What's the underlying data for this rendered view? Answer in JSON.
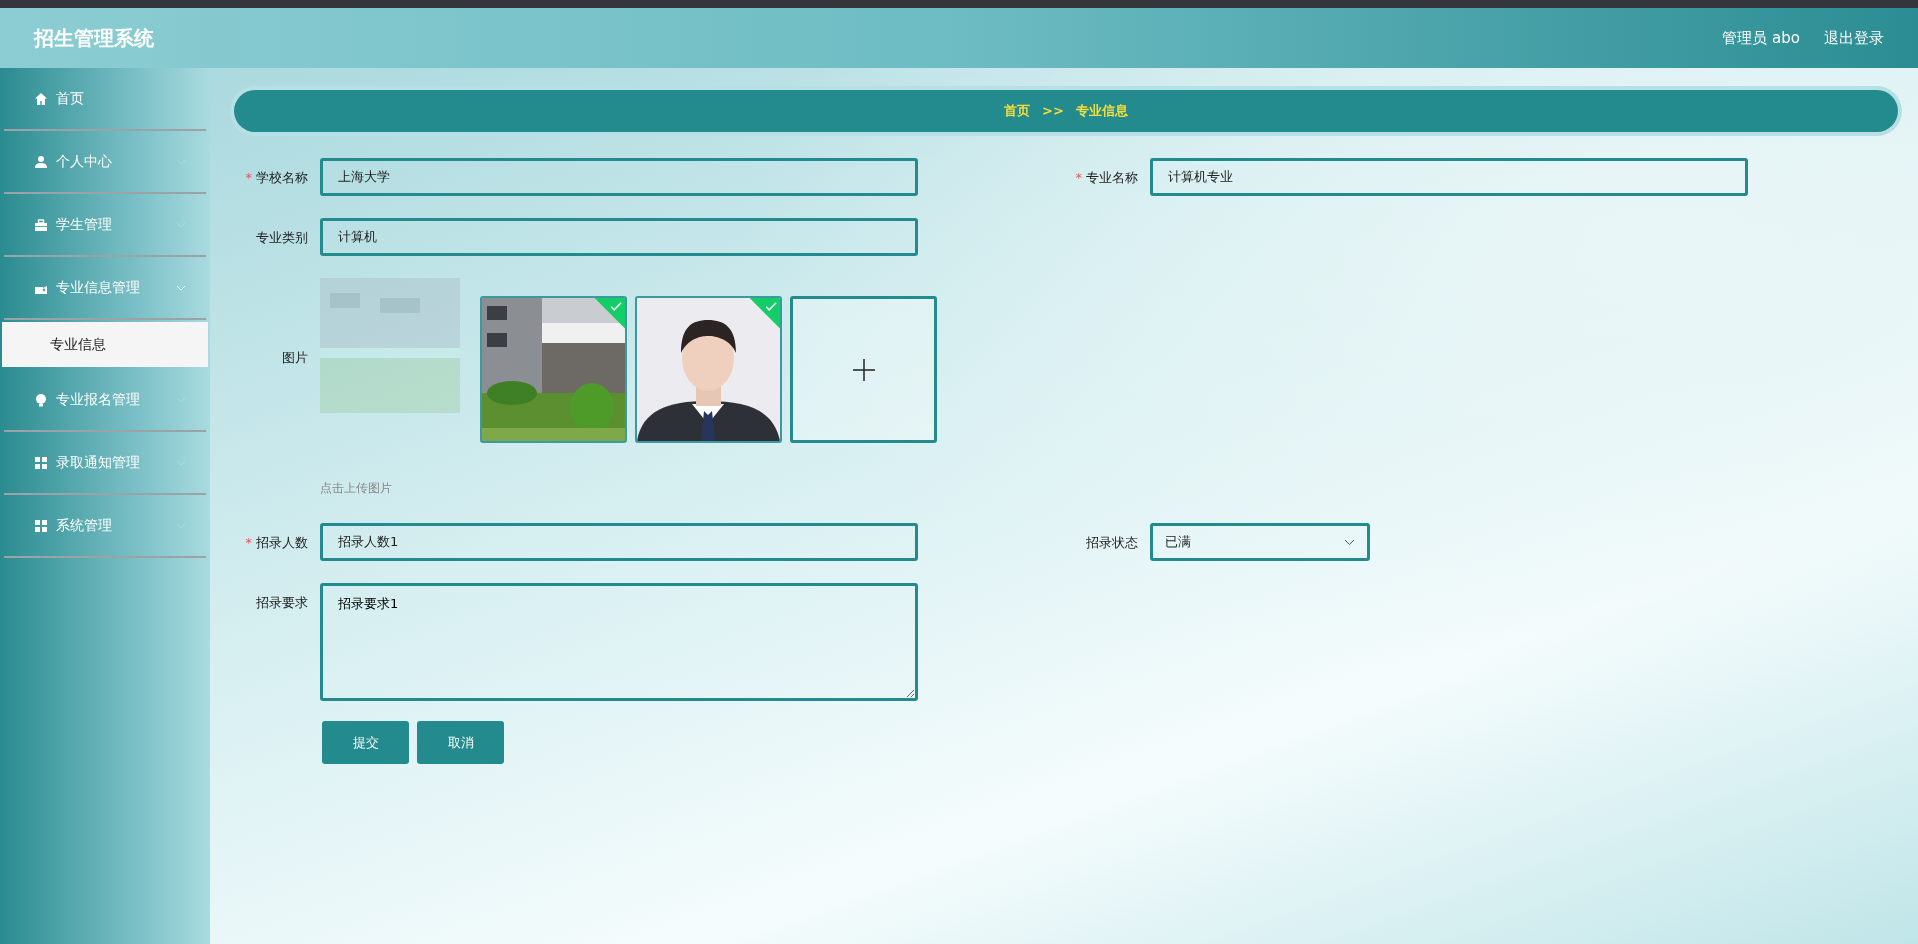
{
  "header": {
    "title": "招生管理系统",
    "user": "管理员 abo",
    "logout": "退出登录"
  },
  "sidebar": {
    "items": [
      {
        "label": "首页"
      },
      {
        "label": "个人中心",
        "expanded": false
      },
      {
        "label": "学生管理",
        "expanded": false
      },
      {
        "label": "专业信息管理",
        "expanded": true,
        "children": [
          {
            "label": "专业信息",
            "selected": true
          }
        ]
      },
      {
        "label": "专业报名管理",
        "expanded": false
      },
      {
        "label": "录取通知管理",
        "expanded": false
      },
      {
        "label": "系统管理",
        "expanded": false
      }
    ]
  },
  "breadcrumb": [
    "首页",
    ">>",
    "专业信息"
  ],
  "form": {
    "school": {
      "label": "学校名称",
      "mark": "*",
      "value": "上海大学"
    },
    "major": {
      "label": "专业名称",
      "mark": "*",
      "value": "计算机专业"
    },
    "category": {
      "label": "专业类别",
      "value": "计算机"
    },
    "images": {
      "label": "图片",
      "hint": "点击上传图片",
      "items": [
        {
          "kind": "picture",
          "uploaded": true
        },
        {
          "kind": "portrait",
          "uploaded": true
        }
      ]
    },
    "count": {
      "label": "招录人数",
      "mark": "*",
      "value": "招录人数1"
    },
    "status": {
      "label": "招录状态",
      "value": "已满"
    },
    "requirement": {
      "label": "招录要求",
      "value": "招录要求1"
    },
    "buttons": [
      "提交",
      "取消"
    ]
  }
}
